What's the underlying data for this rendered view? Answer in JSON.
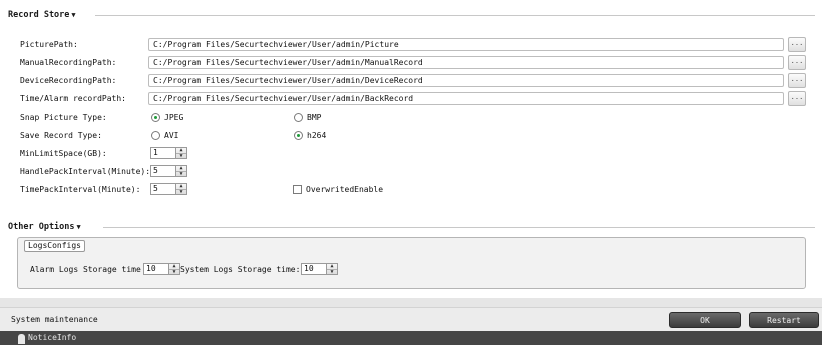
{
  "record_store": {
    "title": "Record Store",
    "arrow": "▼",
    "paths": [
      {
        "label": "PicturePath:",
        "value": "C:/Program Files/Securtechviewer/User/admin/Picture",
        "browse": "..."
      },
      {
        "label": "ManualRecordingPath:",
        "value": "C:/Program Files/Securtechviewer/User/admin/ManualRecord",
        "browse": "..."
      },
      {
        "label": "DeviceRecordingPath:",
        "value": "C:/Program Files/Securtechviewer/User/admin/DeviceRecord",
        "browse": "..."
      },
      {
        "label": "Time/Alarm recordPath:",
        "value": "C:/Program Files/Securtechviewer/User/admin/BackRecord",
        "browse": "..."
      }
    ],
    "snap_picture_type": {
      "label": "Snap Picture Type:",
      "options": [
        "JPEG",
        "BMP"
      ],
      "selected": "JPEG"
    },
    "save_record_type": {
      "label": "Save Record Type:",
      "options": [
        "AVI",
        "h264"
      ],
      "selected": "h264"
    },
    "min_limit_space": {
      "label": "MinLimitSpace(GB):",
      "value": "1"
    },
    "handle_pack_interval": {
      "label": "HandlePackInterval(Minute):",
      "value": "5"
    },
    "time_pack_interval": {
      "label": "TimePackInterval(Minute):",
      "value": "5"
    },
    "overwrite": {
      "label": "OverwritedEnable",
      "checked": false
    }
  },
  "other_options": {
    "title": "Other Options",
    "arrow": "▼",
    "logs_configs": {
      "title": "LogsConfigs",
      "alarm_label": "Alarm Logs Storage time",
      "alarm_value": "10",
      "system_label": "System Logs Storage time:",
      "system_value": "10"
    }
  },
  "status": {
    "text": "System maintenance",
    "ok": "OK",
    "restart": "Restart"
  },
  "notice": {
    "text": "NoticeInfo"
  },
  "icons": {
    "spin_up": "▲",
    "spin_down": "▼"
  }
}
